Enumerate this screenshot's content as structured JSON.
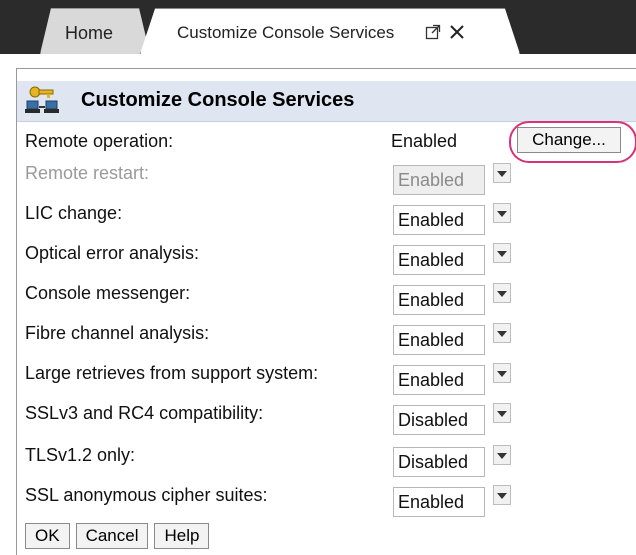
{
  "tabs": {
    "home_label": "Home",
    "active_label": "Customize Console Services"
  },
  "panel": {
    "title": "Customize Console Services",
    "icon": "console-services-key-icon"
  },
  "remote_operation": {
    "label": "Remote operation:",
    "value": "Enabled",
    "change_label": "Change..."
  },
  "settings": [
    {
      "label": "Remote restart:",
      "value": "Enabled",
      "disabled": true
    },
    {
      "label": "LIC change:",
      "value": "Enabled",
      "disabled": false
    },
    {
      "label": "Optical error analysis:",
      "value": "Enabled",
      "disabled": false
    },
    {
      "label": "Console messenger:",
      "value": "Enabled",
      "disabled": false
    },
    {
      "label": "Fibre channel analysis:",
      "value": "Enabled",
      "disabled": false
    },
    {
      "label": "Large retrieves from support system:",
      "value": "Enabled",
      "disabled": false
    },
    {
      "label": "SSLv3 and RC4 compatibility:",
      "value": "Disabled",
      "disabled": false
    },
    {
      "label": "TLSv1.2 only:",
      "value": "Disabled",
      "disabled": false
    },
    {
      "label": "SSL anonymous cipher suites:",
      "value": "Enabled",
      "disabled": false
    }
  ],
  "footer": {
    "ok_label": "OK",
    "cancel_label": "Cancel",
    "help_label": "Help"
  },
  "colors": {
    "highlight": "#d6337a",
    "titlebar": "#dfe6f2"
  }
}
